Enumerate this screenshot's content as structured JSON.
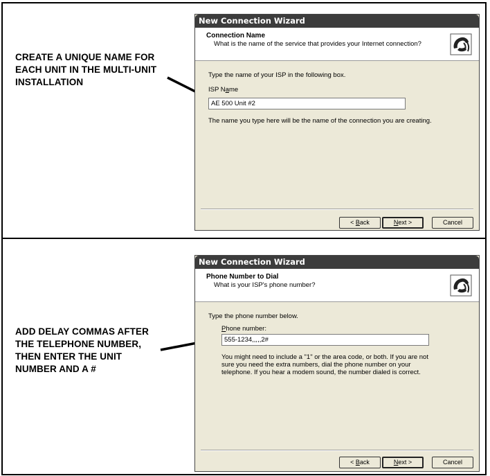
{
  "callouts": [
    {
      "lines": [
        "CREATE A UNIQUE NAME FOR",
        "EACH UNIT IN THE MULTI-UNIT",
        "INSTALLATION"
      ]
    },
    {
      "lines": [
        "ADD DELAY COMMAS AFTER",
        "THE TELEPHONE NUMBER,",
        "THEN ENTER THE UNIT",
        "NUMBER AND A #"
      ]
    }
  ],
  "wizard1": {
    "title": "New Connection Wizard",
    "header_title": "Connection Name",
    "header_subtitle": "What is the name of the service that provides your Internet connection?",
    "icon": "phone-connection-icon",
    "instruction": "Type the name of your ISP in the following box.",
    "field_label_pre": "ISP N",
    "field_label_u": "a",
    "field_label_post": "me",
    "field_value": "AE 500 Unit #2",
    "note": "The name you type here will be the name of the connection you are creating.",
    "back_pre": "< ",
    "back_u": "B",
    "back_post": "ack",
    "next_u": "N",
    "next_post": "ext >",
    "cancel": "Cancel"
  },
  "wizard2": {
    "title": "New Connection Wizard",
    "header_title": "Phone Number to Dial",
    "header_subtitle": "What is your ISP's phone number?",
    "icon": "phone-connection-icon",
    "instruction": "Type the phone number below.",
    "field_label_u": "P",
    "field_label_post": "hone number:",
    "field_value": "555-1234,,,,,2#",
    "note": "You might need to include a \"1\" or the area code, or both. If you are not sure you need the extra numbers, dial the phone number on your telephone. If you hear a modem sound, the number dialed is correct.",
    "back_pre": "< ",
    "back_u": "B",
    "back_post": "ack",
    "next_u": "N",
    "next_post": "ext >",
    "cancel": "Cancel"
  }
}
